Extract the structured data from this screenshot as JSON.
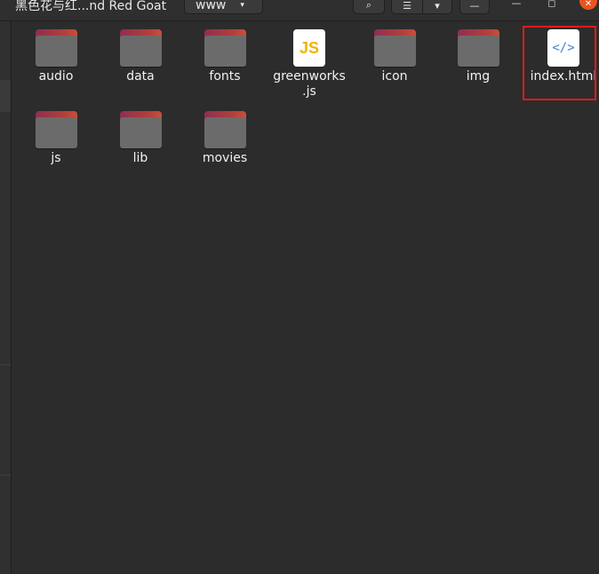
{
  "header": {
    "breadcrumb_parent": "黑色花与红...nd Red Goat",
    "breadcrumb_current": "www",
    "chevron": "▾",
    "search_icon": "⌕",
    "view_icon": "☰",
    "view_options_icon": "▾",
    "menu_icon": "—",
    "minimize": "—",
    "maximize": "◻",
    "close": "✕"
  },
  "items": [
    {
      "label": "audio",
      "type": "folder"
    },
    {
      "label": "data",
      "type": "folder"
    },
    {
      "label": "fonts",
      "type": "folder"
    },
    {
      "label": "greenworks\n.js",
      "label_line1": "greenworks",
      "label_line2": ".js",
      "type": "js-file",
      "glyph": "JS"
    },
    {
      "label": "icon",
      "type": "folder"
    },
    {
      "label": "img",
      "type": "folder"
    },
    {
      "label": "index.html",
      "type": "html-file",
      "glyph": "</>",
      "highlighted": true
    },
    {
      "label": "js",
      "type": "folder"
    },
    {
      "label": "lib",
      "type": "folder"
    },
    {
      "label": "movies",
      "type": "folder"
    }
  ],
  "colors": {
    "highlight": "#e01b1b",
    "folder_tab": "#b2403a",
    "folder_body": "#6b6b6b",
    "close_button": "#e95420"
  }
}
